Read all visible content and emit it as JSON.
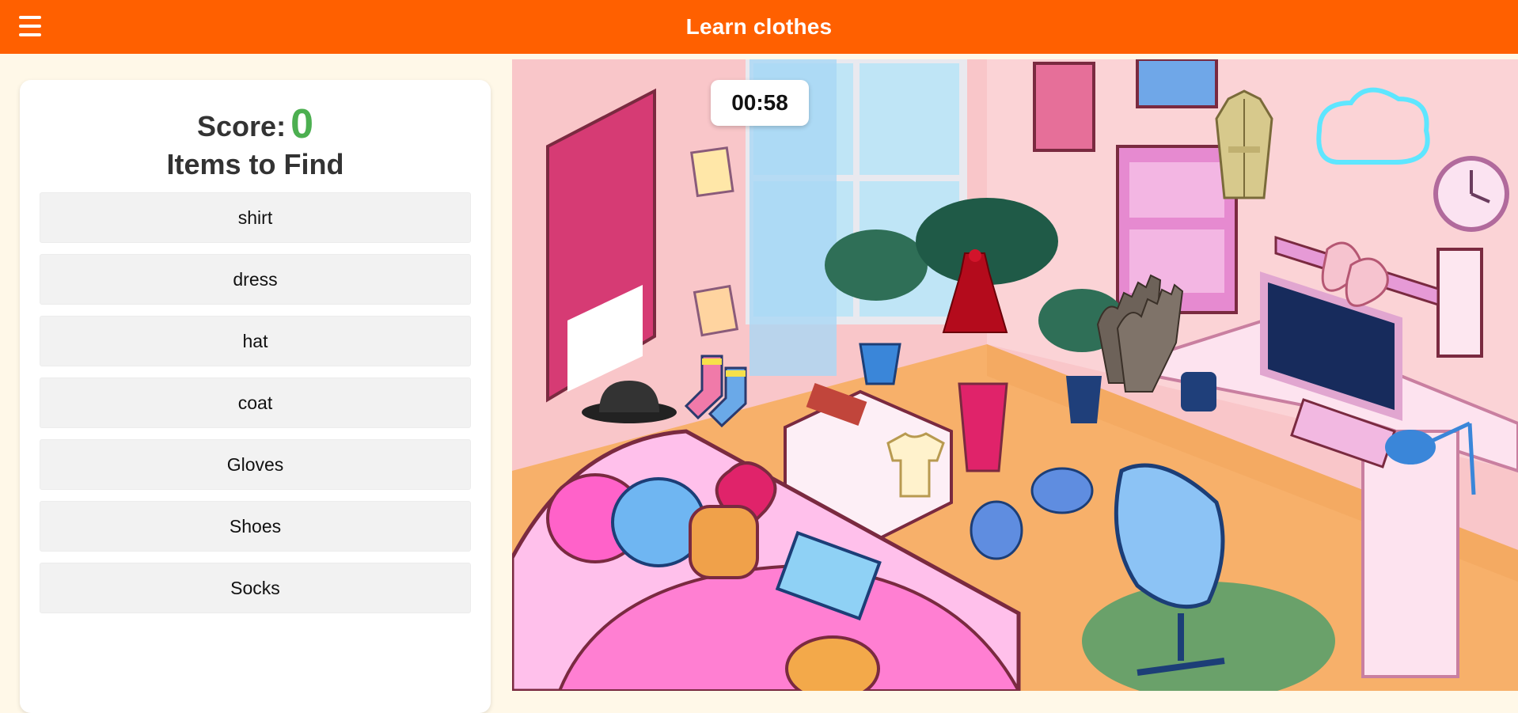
{
  "header": {
    "title": "Learn clothes",
    "menu_icon": "hamburger-menu-icon"
  },
  "sidebar": {
    "score_label": "Score:",
    "score_value": "0",
    "items_title": "Items to Find",
    "items": [
      {
        "label": "shirt"
      },
      {
        "label": "dress"
      },
      {
        "label": "hat"
      },
      {
        "label": "coat"
      },
      {
        "label": "Gloves"
      },
      {
        "label": "Shoes"
      },
      {
        "label": "Socks"
      }
    ]
  },
  "game": {
    "timer": "00:58"
  },
  "colors": {
    "accent": "#ff6000",
    "score": "#4caf50",
    "item_bg": "#f2f2f2",
    "page_bg": "#fff8e8"
  }
}
